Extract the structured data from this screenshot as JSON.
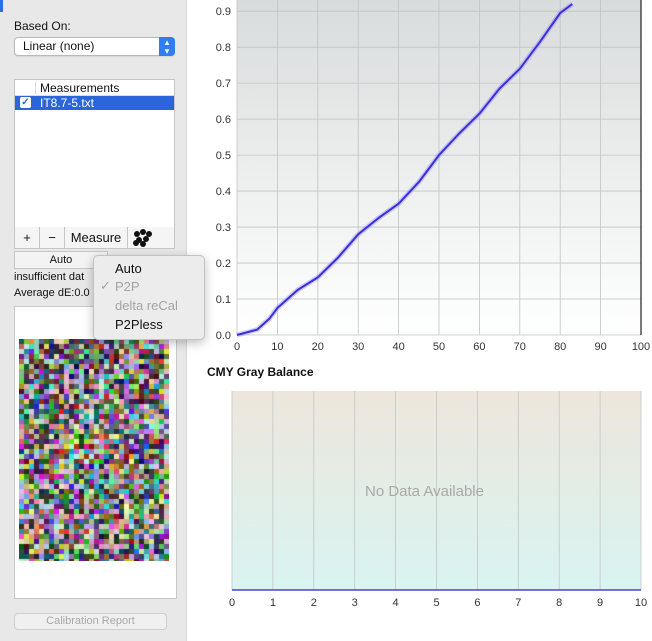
{
  "left": {
    "based_on_label": "Based On:",
    "based_on_value": "Linear (none)",
    "measurements_header": "Measurements",
    "measurement_row": "IT8.7-5.txt",
    "add_label": "+",
    "remove_label": "−",
    "measure_label": "Measure",
    "auto_button": "Auto",
    "status_text": "insufficient dat",
    "average_de": "Average dE:0.0",
    "calibration_report": "Calibration Report"
  },
  "popup_menu": {
    "items": [
      "Auto",
      "P2P",
      "delta reCal",
      "P2Pless"
    ],
    "checked": "P2P",
    "disabled": [
      "P2P",
      "delta reCal"
    ]
  },
  "top_chart": {
    "y_tick_labels": [
      "0.0",
      "0.1",
      "0.2",
      "0.3",
      "0.4",
      "0.5",
      "0.6",
      "0.7",
      "0.8",
      "0.9"
    ],
    "x_tick_labels": [
      "0",
      "10",
      "20",
      "30",
      "40",
      "50",
      "60",
      "70",
      "80",
      "90",
      "100"
    ],
    "line_color": "#3a2ee0"
  },
  "bottom_chart": {
    "title": "CMY Gray Balance",
    "no_data": "No Data Available",
    "x_tick_labels": [
      "0",
      "1",
      "2",
      "3",
      "4",
      "5",
      "6",
      "7",
      "8",
      "9",
      "10"
    ]
  },
  "chart_data": [
    {
      "type": "line",
      "title": "",
      "xlabel": "",
      "ylabel": "",
      "xlim": [
        0,
        100
      ],
      "ylim": [
        0,
        0.92
      ],
      "grid": true,
      "series": [
        {
          "x": [
            0,
            5,
            8,
            10,
            15,
            20,
            25,
            30,
            35,
            40,
            45,
            50,
            55,
            60,
            65,
            70,
            75,
            80,
            83
          ],
          "y": [
            0.0,
            0.015,
            0.045,
            0.075,
            0.125,
            0.16,
            0.215,
            0.28,
            0.325,
            0.365,
            0.425,
            0.5,
            0.56,
            0.615,
            0.685,
            0.74,
            0.815,
            0.895,
            0.92
          ]
        }
      ]
    },
    {
      "type": "line",
      "title": "CMY Gray Balance",
      "xlim": [
        0,
        10
      ],
      "grid": true,
      "series": []
    }
  ]
}
